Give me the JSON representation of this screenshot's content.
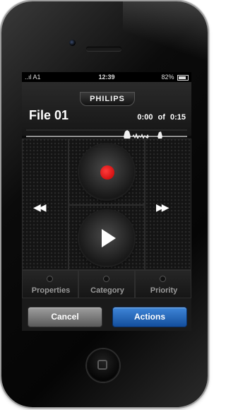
{
  "status": {
    "signal": "..ıl A1",
    "time": "12:39",
    "battery": "82%"
  },
  "header": {
    "brand": "PHILIPS",
    "file_title": "File 01",
    "elapsed": "0:00",
    "of_label": "of",
    "total": "0:15"
  },
  "transport": {
    "rewind_icon": "rewind-icon",
    "forward_icon": "fast-forward-icon",
    "record_icon": "record-icon",
    "play_icon": "play-icon"
  },
  "tabs": [
    {
      "label": "Properties"
    },
    {
      "label": "Category"
    },
    {
      "label": "Priority"
    }
  ],
  "buttons": {
    "cancel": "Cancel",
    "actions": "Actions"
  },
  "colors": {
    "record": "#d40000",
    "actions_button": "#1f5fb0",
    "cancel_button": "#7a7a7a"
  }
}
